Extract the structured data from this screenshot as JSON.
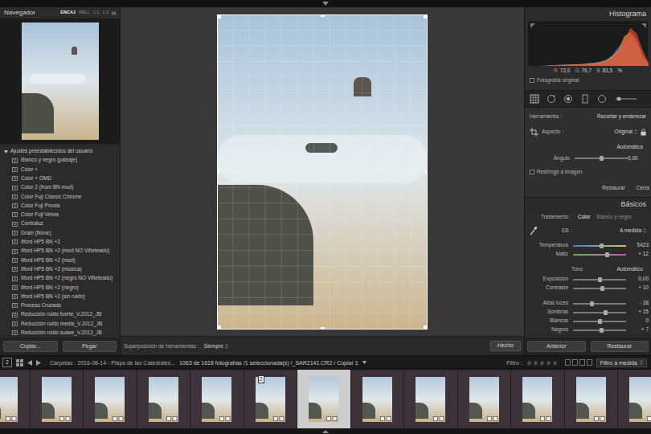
{
  "navigator": {
    "title": "Navegador",
    "zoom_options": [
      {
        "label": "ENCAJ",
        "selected": true
      },
      {
        "label": "RELL",
        "selected": false
      },
      {
        "label": "1:1",
        "selected": false
      },
      {
        "label": "1:3",
        "selected": false
      }
    ]
  },
  "presets": {
    "header": "Ajustes preestablecidos del usuario",
    "expanded": true,
    "items": [
      "Blanco y negro (paisaje)",
      "Color +",
      "Color + OMD",
      "Color 2 (from BN mod)",
      "Color Fuji Classic Chrome",
      "Color Fuji Provia",
      "Color Fuji Velvia",
      "Contraluz",
      "Grain (None)",
      "Ilford HP5 BN +2",
      "Ilford HP5 BN +2 (mod NO Viñeteado)",
      "Ilford HP5 BN +2 (mod)",
      "Ilford HP5 BN +2 (música)",
      "Ilford HP5 BN +2 (negro NO Viñeteado)",
      "Ilford HP5 BN +2 (negro)",
      "Ilford HP5 BN +2 (sin ruido)",
      "Proceso Cruzado",
      "Reducción ruido fuerte_V.2012_JB",
      "Reducción ruido media_V.2012_JB",
      "Reducción ruido suave_V.2012_JB"
    ]
  },
  "left_buttons": [
    "Copiar...",
    "Pegar"
  ],
  "toolbar": {
    "label": "Superposición de herramientas :",
    "value": "Siempre",
    "done_button": "Hecho"
  },
  "histogram": {
    "title": "Histograma",
    "series": [
      {
        "name": "blue",
        "color": "#4f6fe0",
        "values": [
          0,
          0,
          0,
          1,
          1,
          2,
          2,
          3,
          3,
          4,
          5,
          6,
          8,
          12,
          20,
          35,
          45,
          50,
          40,
          15,
          3
        ]
      },
      {
        "name": "green",
        "color": "#d9c23c",
        "values": [
          0,
          0,
          0,
          0,
          1,
          1,
          2,
          2,
          3,
          3,
          4,
          5,
          7,
          10,
          18,
          30,
          55,
          62,
          48,
          20,
          4
        ]
      },
      {
        "name": "red",
        "color": "#e0453a",
        "values": [
          0,
          0,
          0,
          0,
          1,
          1,
          1,
          2,
          2,
          3,
          3,
          4,
          6,
          9,
          15,
          28,
          50,
          70,
          60,
          30,
          6
        ]
      }
    ],
    "readout": [
      {
        "label": "R",
        "value": "72,0"
      },
      {
        "label": "G",
        "value": "76,7"
      },
      {
        "label": "B",
        "value": "83,5"
      }
    ],
    "unit": "%",
    "original": {
      "label": "Fotografía original",
      "checked": false
    }
  },
  "crop": {
    "tool_label": "Herramienta :",
    "tool_value": "Recortar y enderezar",
    "aspect_label": "Aspecto :",
    "aspect_value": "Original",
    "locked": true,
    "auto": "Automática",
    "angle": {
      "label": "Ángulo",
      "value": "0,00",
      "level": 0.5,
      "kind": "plain"
    },
    "constrain": {
      "label": "Restringir a imagen",
      "checked": false
    },
    "buttons": [
      "Restaurar",
      "Cerra"
    ]
  },
  "basics": {
    "title": "Básicos",
    "treatment_label": "Tratamiento :",
    "treatments": [
      {
        "label": "Color",
        "selected": true
      },
      {
        "label": "Blanco y negro",
        "selected": false
      }
    ],
    "wb_label": "EB :",
    "wb_value": "A medida",
    "wb_sliders": [
      {
        "label": "Temperatura",
        "value": "5423",
        "level": 0.53,
        "kind": "temperature"
      },
      {
        "label": "Matiz",
        "value": "+ 12",
        "level": 0.64,
        "kind": "tint"
      }
    ],
    "tone_label": "Tono",
    "tone_auto": "Automático",
    "tone_sliders": [
      {
        "label": "Exposición",
        "value": "0,00",
        "level": 0.5,
        "kind": "plain"
      },
      {
        "label": "Contraste",
        "value": "+ 10",
        "level": 0.55,
        "kind": "plain"
      },
      {
        "label": "Altas luces",
        "value": "- 38",
        "level": 0.35,
        "kind": "plain"
      },
      {
        "label": "Sombras",
        "value": "+ 15",
        "level": 0.6,
        "kind": "plain"
      },
      {
        "label": "Blancos",
        "value": "0",
        "level": 0.5,
        "kind": "plain"
      },
      {
        "label": "Negros",
        "value": "+ 7",
        "level": 0.53,
        "kind": "plain"
      }
    ]
  },
  "right_buttons": [
    "Anterior",
    "Restaurar"
  ],
  "filmbar": {
    "page": "2",
    "path": "Carpetas : 2016-08-14 - Playa de las Catedrales...",
    "count": "1063 de 1618 fotografías /1 seleccionada(s) /_SAR2141.CR2 / Copiar 1",
    "filter_label": "Filtro :",
    "stars": 0,
    "filter_value": "Filtro a medida"
  },
  "filmstrip": [
    {
      "selected": false
    },
    {
      "selected": false
    },
    {
      "selected": false
    },
    {
      "selected": false
    },
    {
      "selected": false
    },
    {
      "selected": false,
      "stack": "2"
    },
    {
      "selected": true
    },
    {
      "selected": false
    },
    {
      "selected": false
    },
    {
      "selected": false
    },
    {
      "selected": false
    },
    {
      "selected": false
    },
    {
      "selected": false
    }
  ]
}
